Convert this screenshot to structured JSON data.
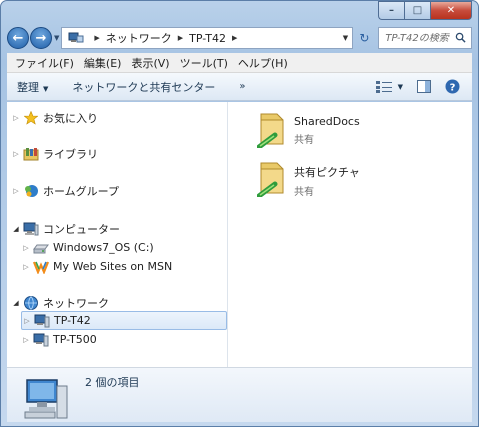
{
  "window": {
    "caption_min": "–",
    "caption_max": "□",
    "caption_close": "✕"
  },
  "address": {
    "segments": [
      "ネットワーク",
      "TP-T42"
    ],
    "search_placeholder": "TP-T42の検索"
  },
  "menu": [
    "ファイル(F)",
    "編集(E)",
    "表示(V)",
    "ツール(T)",
    "ヘルプ(H)"
  ],
  "toolbar": {
    "organize": "整理",
    "network_center": "ネットワークと共有センター",
    "more": "»"
  },
  "nav": {
    "favorites": "お気に入り",
    "libraries": "ライブラリ",
    "homegroup": "ホームグループ",
    "computer": "コンピューター",
    "drive_c": "Windows7_OS (C:)",
    "msn": "My Web Sites on MSN",
    "network": "ネットワーク",
    "tp_t42": "TP-T42",
    "tp_t500": "TP-T500"
  },
  "files": [
    {
      "name": "SharedDocs",
      "type": "共有"
    },
    {
      "name": "共有ピクチャ",
      "type": "共有"
    }
  ],
  "details": {
    "count": "2 個の項目"
  },
  "colors": {
    "accent": "#1f5fa8",
    "selection": "#dce9f8",
    "close": "#c74c3c"
  },
  "icons": [
    "back-icon",
    "forward-icon",
    "refresh-icon",
    "search-icon",
    "star-icon",
    "library-icon",
    "homegroup-icon",
    "computer-icon",
    "drive-icon",
    "msn-icon",
    "network-icon",
    "pc-icon",
    "shared-folder-icon",
    "view-icon",
    "preview-pane-icon",
    "help-icon"
  ]
}
